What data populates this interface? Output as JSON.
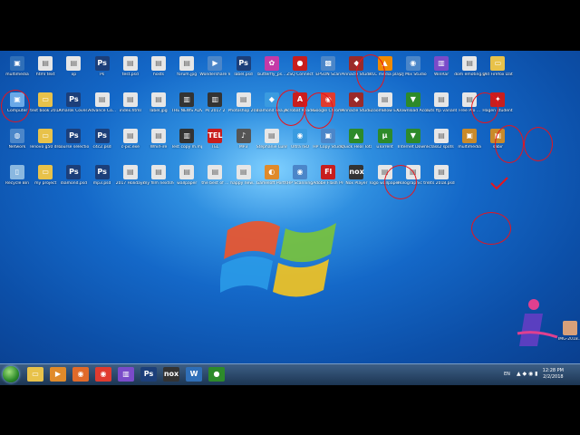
{
  "desktop": {
    "icons": [
      {
        "label": "multimedia",
        "glyph": "▣",
        "color": "#2f6fb8"
      },
      {
        "label": "html text",
        "glyph": "▤",
        "color": "#e6e6e6"
      },
      {
        "label": "xp",
        "glyph": "▤",
        "color": "#e6e6e6"
      },
      {
        "label": "Ps",
        "glyph": "Ps",
        "color": "#1c3f7a"
      },
      {
        "label": "test.psd",
        "glyph": "▤",
        "color": "#e6e6e6"
      },
      {
        "label": "hosts",
        "glyph": "▤",
        "color": "#e6e6e6"
      },
      {
        "label": "forum.jpg",
        "glyph": "▤",
        "color": "#e6e6e6"
      },
      {
        "label": "Wondershare Video Edition",
        "glyph": "▶",
        "color": "#4b86c9"
      },
      {
        "label": "label.psd",
        "glyph": "Ps",
        "color": "#1c3f7a"
      },
      {
        "label": "butterfly_ps...",
        "glyph": "✿",
        "color": "#c53aa7"
      },
      {
        "label": "ZSQ Connect",
        "glyph": "●",
        "color": "#c81e1e"
      },
      {
        "label": "EPSON Scan",
        "glyph": "▩",
        "color": "#4b86c9"
      },
      {
        "label": "Pinnacle Studio 12",
        "glyph": "◆",
        "color": "#9a2a2a"
      },
      {
        "label": "VLC media player",
        "glyph": "▲",
        "color": "#f08a00"
      },
      {
        "label": "DJ Mix Studio",
        "glyph": "◉",
        "color": "#4b86c9"
      },
      {
        "label": "WinRar",
        "glyph": "▥",
        "color": "#7a4bc9"
      },
      {
        "label": "dom emoting.jpg",
        "glyph": "▤",
        "color": "#e6e6e6"
      },
      {
        "label": "Old Firefox Data",
        "glyph": "▭",
        "color": "#e8c24a"
      },
      {
        "label": "Computer",
        "glyph": "▣",
        "color": "#6aa9e8"
      },
      {
        "label": "text book 2017",
        "glyph": "▭",
        "color": "#e8c24a"
      },
      {
        "label": "Amarok Cover3.psd",
        "glyph": "Ps",
        "color": "#1c3f7a"
      },
      {
        "label": "Advance Co...",
        "glyph": "▤",
        "color": "#e6e6e6"
      },
      {
        "label": "index.html",
        "glyph": "▤",
        "color": "#e6e6e6"
      },
      {
        "label": "label.jpg",
        "glyph": "▤",
        "color": "#e6e6e6"
      },
      {
        "label": "THE NEWS ADV.jpg",
        "glyph": "▥",
        "color": "#333"
      },
      {
        "label": "Ps 2017 2",
        "glyph": "▥",
        "color": "#333"
      },
      {
        "label": "Photoshop 2017 E...",
        "glyph": "▤",
        "color": "#e6e6e6"
      },
      {
        "label": "diamond sea.png",
        "glyph": "◆",
        "color": "#3a9be0"
      },
      {
        "label": "Acrobat Reader",
        "glyph": "A",
        "color": "#c81e1e"
      },
      {
        "label": "Google Chrome",
        "glyph": "◉",
        "color": "#e03b2f"
      },
      {
        "label": "Pinnacle Studio 16",
        "glyph": "◆",
        "color": "#9a2a2a"
      },
      {
        "label": "ZoomBlow EX",
        "glyph": "▤",
        "color": "#e6e6e6"
      },
      {
        "label": "Download Accelerator",
        "glyph": "▼",
        "color": "#2d8a2a"
      },
      {
        "label": "cuts ftp variant.docx",
        "glyph": "▤",
        "color": "#e6e6e6"
      },
      {
        "label": "Free Pro ...",
        "glyph": "▤",
        "color": "#e6e6e6"
      },
      {
        "label": "Hagen student...",
        "glyph": "✦",
        "color": "#c81e1e"
      },
      {
        "label": "Network",
        "glyph": "◍",
        "color": "#4b86c9"
      },
      {
        "label": "lenovo g50 driver",
        "glyph": "▭",
        "color": "#e8c24a"
      },
      {
        "label": "course selection",
        "glyph": "Ps",
        "color": "#1c3f7a"
      },
      {
        "label": "c4c2.psd",
        "glyph": "Ps",
        "color": "#1c3f7a"
      },
      {
        "label": "c-pic.exe",
        "glyph": "▤",
        "color": "#e6e6e6"
      },
      {
        "label": "WhirFire",
        "glyph": "▤",
        "color": "#e6e6e6"
      },
      {
        "label": "Test copy m.mp4",
        "glyph": "▥",
        "color": "#333"
      },
      {
        "label": "TEL",
        "glyph": "TEL",
        "color": "#c81e1e"
      },
      {
        "label": "MP3",
        "glyph": "♪",
        "color": "#555"
      },
      {
        "label": "Stephanie Lunita",
        "glyph": "▤",
        "color": "#e6e6e6"
      },
      {
        "label": "Ultra ISO",
        "glyph": "◉",
        "color": "#3a9be0"
      },
      {
        "label": "HP Copy Studio",
        "glyph": "▣",
        "color": "#4b86c9"
      },
      {
        "label": "Quick Heal Total Security",
        "glyph": "▲",
        "color": "#2d8a2a"
      },
      {
        "label": "uTorrent",
        "glyph": "μ",
        "color": "#2d8a2a"
      },
      {
        "label": "Internet Downlo...",
        "glyph": "▼",
        "color": "#2d8a2a"
      },
      {
        "label": "class2 spots",
        "glyph": "▤",
        "color": "#e6e6e6"
      },
      {
        "label": "multimedia",
        "glyph": "▣",
        "color": "#c98a2a"
      },
      {
        "label": "sabir",
        "glyph": "▣",
        "color": "#c98a2a"
      },
      {
        "label": "Recycle Bin",
        "glyph": "▯",
        "color": "#8ab8e0"
      },
      {
        "label": "my project",
        "glyph": "▭",
        "color": "#e8c24a"
      },
      {
        "label": "diamond.psd",
        "glyph": "Ps",
        "color": "#1c3f7a"
      },
      {
        "label": "mp3.psd",
        "glyph": "Ps",
        "color": "#1c3f7a"
      },
      {
        "label": "2017 Holidays",
        "glyph": "▤",
        "color": "#e6e6e6"
      },
      {
        "label": "my film nextshot",
        "glyph": "▤",
        "color": "#e6e6e6"
      },
      {
        "label": "wallpaper",
        "glyph": "▤",
        "color": "#e6e6e6"
      },
      {
        "label": "the best of ...",
        "glyph": "▤",
        "color": "#e6e6e6"
      },
      {
        "label": "happy new...",
        "glyph": "▤",
        "color": "#e6e6e6"
      },
      {
        "label": "Gameloft Portfolio",
        "glyph": "◐",
        "color": "#e08a2a"
      },
      {
        "label": "HP Scanning",
        "glyph": "◉",
        "color": "#4b86c9"
      },
      {
        "label": "Adobe Flash Professional",
        "glyph": "Fl",
        "color": "#c81e1e"
      },
      {
        "label": "Nox Player",
        "glyph": "nox",
        "color": "#333"
      },
      {
        "label": "logo wallpaper",
        "glyph": "▤",
        "color": "#e6e6e6"
      },
      {
        "label": "Holographic tree man",
        "glyph": "▤",
        "color": "#e6e6e6"
      },
      {
        "label": "nts 2018.psd",
        "glyph": "▤",
        "color": "#e6e6e6"
      }
    ]
  },
  "taskbar": {
    "apps": [
      {
        "label": "Windows Explorer",
        "glyph": "▭",
        "color": "#e8c24a"
      },
      {
        "label": "Media Player",
        "glyph": "▶",
        "color": "#e08a2a"
      },
      {
        "label": "Firefox",
        "glyph": "◉",
        "color": "#e06a2a"
      },
      {
        "label": "Chrome",
        "glyph": "◉",
        "color": "#e03b2f"
      },
      {
        "label": "Video",
        "glyph": "▥",
        "color": "#7a4bc9"
      },
      {
        "label": "Photoshop",
        "glyph": "Ps",
        "color": "#1c3f7a"
      },
      {
        "label": "Nox",
        "glyph": "nox",
        "color": "#333"
      },
      {
        "label": "Word",
        "glyph": "W",
        "color": "#2f6fb8"
      },
      {
        "label": "Camtasia",
        "glyph": "●",
        "color": "#2d8a2a"
      }
    ],
    "lang": "EN",
    "time": "12:28 PM",
    "date": "2/2/2018"
  }
}
